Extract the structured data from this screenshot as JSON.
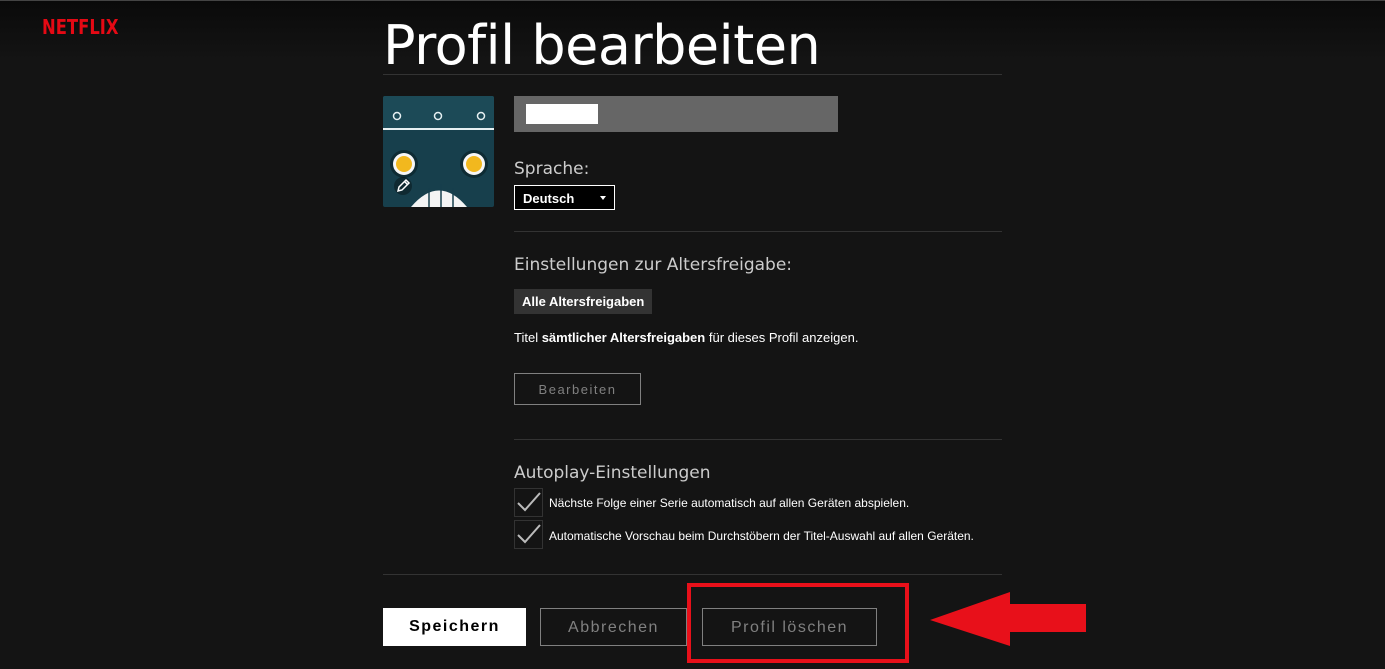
{
  "brand": {
    "logo_text": "NETFLIX",
    "color": "#e50914"
  },
  "page": {
    "title": "Profil bearbeiten"
  },
  "profile": {
    "name_value": ""
  },
  "language": {
    "label": "Sprache:",
    "selected": "Deutsch"
  },
  "maturity": {
    "heading": "Einstellungen zur Altersfreigabe:",
    "badge": "Alle Altersfreigaben",
    "desc_prefix": "Titel ",
    "desc_bold": "sämtlicher Altersfreigaben",
    "desc_suffix": " für dieses Profil anzeigen.",
    "edit_button": "Bearbeiten"
  },
  "autoplay": {
    "heading": "Autoplay-Einstellungen",
    "options": [
      {
        "label": "Nächste Folge einer Serie automatisch auf allen Geräten abspielen.",
        "checked": true
      },
      {
        "label": "Automatische Vorschau beim Durchstöbern der Titel-Auswahl auf allen Geräten.",
        "checked": true
      }
    ]
  },
  "actions": {
    "save": "Speichern",
    "cancel": "Abbrechen",
    "delete": "Profil löschen"
  },
  "annotation": {
    "highlight_color": "#e8101a",
    "arrow_icon": "left-arrow-icon"
  }
}
